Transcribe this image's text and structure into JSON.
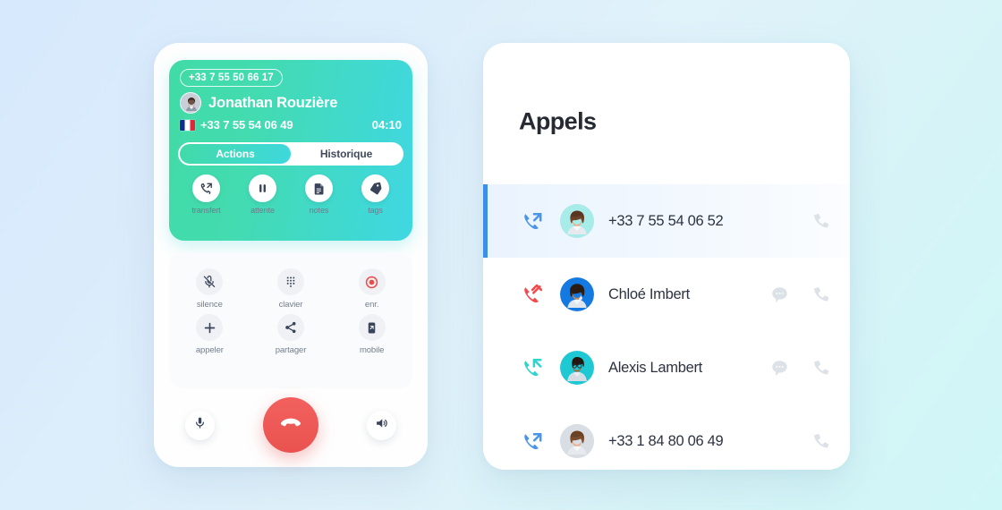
{
  "theme": {
    "background_from": "#d6e9fd",
    "background_to": "#d0f7f7",
    "accent_teal": "#41dba8",
    "accent_cyan": "#3fd8e2",
    "accent_blue": "#3d8eea",
    "danger_red": "#e9524f",
    "muted_grey": "#dbe0e8"
  },
  "phone_card": {
    "call_panel": {
      "number_badge": "+33 7 55 50 66 17",
      "caller_name": "Jonathan Rouzière",
      "line_number": "+33 7 55 54 06 49",
      "timer": "04:10",
      "flag_icon": "france-flag-icon",
      "avatar_icon": "caller-avatar",
      "tabs": [
        {
          "label": "Actions",
          "active": true
        },
        {
          "label": "Historique",
          "active": false
        }
      ],
      "actions": [
        {
          "label": "transfert",
          "icon": "transfer-call-icon"
        },
        {
          "label": "attente",
          "icon": "pause-icon"
        },
        {
          "label": "notes",
          "icon": "document-icon"
        },
        {
          "label": "tags",
          "icon": "tag-icon"
        }
      ]
    },
    "controls": [
      {
        "label": "silence",
        "icon": "microphone-muted-icon"
      },
      {
        "label": "clavier",
        "icon": "dialpad-icon"
      },
      {
        "label": "enr.",
        "icon": "record-icon"
      },
      {
        "label": "appeler",
        "icon": "plus-icon"
      },
      {
        "label": "partager",
        "icon": "share-icon"
      },
      {
        "label": "mobile",
        "icon": "mobile-phone-icon"
      }
    ],
    "bottom_bar": {
      "mic_icon": "microphone-icon",
      "hangup_icon": "hangup-phone-icon",
      "speaker_icon": "speaker-icon"
    }
  },
  "calls_card": {
    "title": "Appels",
    "rows": [
      {
        "label": "+33 7 55 54 06 52",
        "direction": "outgoing",
        "direction_icon": "outgoing-call-icon",
        "avatar": "avatar-woman-curly",
        "active": true,
        "has_message_action": false,
        "call_action_icon": "phone-icon"
      },
      {
        "label": "Chloé Imbert",
        "direction": "missed",
        "direction_icon": "missed-call-icon",
        "avatar": "avatar-woman-phone",
        "active": false,
        "has_message_action": true,
        "message_action_icon": "chat-bubble-icon",
        "call_action_icon": "phone-icon"
      },
      {
        "label": "Alexis Lambert",
        "direction": "incoming",
        "direction_icon": "incoming-call-icon",
        "avatar": "avatar-man-glasses",
        "active": false,
        "has_message_action": true,
        "message_action_icon": "chat-bubble-icon",
        "call_action_icon": "phone-icon"
      },
      {
        "label": "+33 1 84 80 06 49",
        "direction": "outgoing",
        "direction_icon": "outgoing-call-icon",
        "avatar": "avatar-woman-curly",
        "active": false,
        "has_message_action": false,
        "call_action_icon": "phone-icon"
      }
    ]
  }
}
